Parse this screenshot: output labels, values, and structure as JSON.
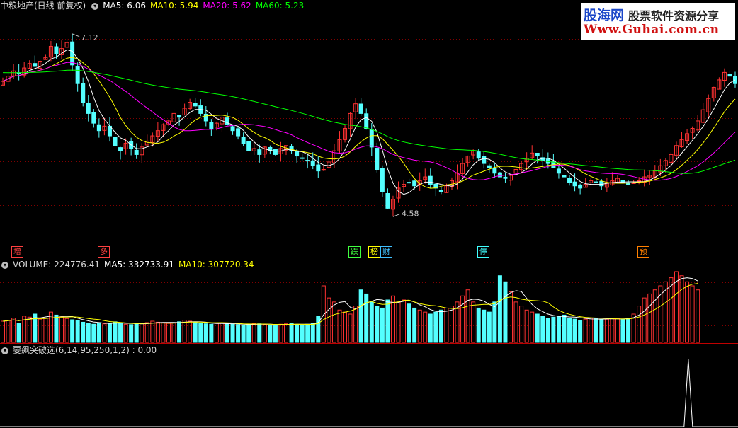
{
  "header": {
    "title": "中粮地产(日线 前复权)",
    "ma5": "MA5: 6.06",
    "ma10": "MA10: 5.94",
    "ma20": "MA20: 5.62",
    "ma60": "MA60: 5.23"
  },
  "volume_header": {
    "title": "VOLUME: 224776.41",
    "ma5": "MA5: 332733.91",
    "ma10": "MA10: 307720.34"
  },
  "indicator_header": {
    "title": "要飙突破选(6,14,95,250,1,2) : 0.00"
  },
  "watermark": {
    "brand": "股海网",
    "slogan": "股票软件资源分享",
    "url": "Www.Guhai.com.cn"
  },
  "colors": {
    "up": "#ff3232",
    "down": "#54ffff",
    "ma5": "#ffffff",
    "ma10": "#ffff00",
    "ma20": "#ff00ff",
    "ma60": "#00ff00",
    "separator": "#c00000"
  },
  "price_markers": {
    "high": "7.12",
    "low": "4.58"
  },
  "event_tags": [
    {
      "text": "增",
      "color": "#ff4040"
    },
    {
      "text": "多",
      "color": "#ff4040"
    },
    {
      "text": "跌",
      "color": "#40ff40"
    },
    {
      "text": "榜",
      "color": "#ffff00"
    },
    {
      "text": "财",
      "color": "#40c0ff"
    },
    {
      "text": "停",
      "color": "#40ffff"
    },
    {
      "text": "预",
      "color": "#ff8000"
    }
  ],
  "chart_data": [
    {
      "type": "candlestick",
      "title": "中粮地产(日线 前复权)",
      "ylim": [
        4.3,
        7.4
      ],
      "series_names": [
        "MA5",
        "MA10",
        "MA20",
        "MA60"
      ],
      "annotations": [
        {
          "label": "7.12",
          "type": "high"
        },
        {
          "label": "4.58",
          "type": "low"
        }
      ],
      "closes": [
        6.48,
        6.55,
        6.62,
        6.58,
        6.66,
        6.72,
        6.68,
        6.75,
        6.8,
        6.95,
        6.85,
        6.92,
        7.0,
        6.7,
        6.45,
        6.2,
        6.05,
        5.92,
        5.82,
        5.88,
        5.75,
        5.62,
        5.55,
        5.65,
        5.58,
        5.5,
        5.6,
        5.68,
        5.75,
        5.82,
        5.9,
        5.95,
        6.05,
        6.0,
        6.12,
        6.2,
        6.15,
        6.05,
        5.95,
        5.85,
        5.92,
        6.0,
        5.9,
        5.82,
        5.75,
        5.65,
        5.55,
        5.58,
        5.5,
        5.6,
        5.55,
        5.5,
        5.58,
        5.62,
        5.55,
        5.48,
        5.45,
        5.42,
        5.35,
        5.28,
        5.3,
        5.4,
        5.55,
        5.7,
        5.85,
        6.05,
        6.18,
        6.05,
        5.85,
        5.6,
        5.3,
        5.0,
        4.78,
        4.9,
        5.05,
        5.1,
        5.12,
        5.08,
        5.15,
        5.2,
        5.1,
        5.05,
        5.0,
        5.08,
        5.15,
        5.25,
        5.38,
        5.48,
        5.55,
        5.45,
        5.38,
        5.32,
        5.25,
        5.2,
        5.18,
        5.22,
        5.3,
        5.38,
        5.45,
        5.52,
        5.48,
        5.42,
        5.38,
        5.32,
        5.25,
        5.2,
        5.12,
        5.08,
        5.05,
        5.1,
        5.15,
        5.12,
        5.08,
        5.12,
        5.15,
        5.18,
        5.12,
        5.1,
        5.12,
        5.15,
        5.2,
        5.22,
        5.28,
        5.35,
        5.42,
        5.5,
        5.62,
        5.7,
        5.78,
        5.85,
        5.95,
        6.1,
        6.25,
        6.4,
        6.5,
        6.6,
        6.55,
        6.45
      ]
    },
    {
      "type": "bar",
      "title": "VOLUME",
      "series_names": [
        "VOLUME",
        "MA5",
        "MA10"
      ],
      "values": [
        105,
        110,
        120,
        95,
        130,
        125,
        140,
        115,
        120,
        150,
        135,
        125,
        118,
        112,
        108,
        100,
        95,
        90,
        98,
        92,
        96,
        102,
        94,
        90,
        88,
        92,
        95,
        98,
        105,
        100,
        96,
        94,
        98,
        102,
        110,
        105,
        98,
        95,
        92,
        90,
        94,
        96,
        92,
        90,
        88,
        85,
        90,
        94,
        92,
        88,
        85,
        86,
        90,
        92,
        94,
        88,
        86,
        90,
        95,
        130,
        280,
        220,
        200,
        160,
        150,
        140,
        180,
        260,
        240,
        200,
        180,
        170,
        210,
        230,
        200,
        210,
        190,
        170,
        160,
        150,
        140,
        150,
        160,
        170,
        180,
        200,
        230,
        260,
        200,
        170,
        160,
        150,
        200,
        330,
        300,
        250,
        200,
        180,
        160,
        150,
        140,
        130,
        120,
        125,
        130,
        135,
        120,
        115,
        110,
        115,
        120,
        118,
        112,
        115,
        120,
        118,
        115,
        120,
        140,
        180,
        220,
        240,
        260,
        280,
        300,
        320,
        350,
        330,
        300,
        280,
        260
      ]
    },
    {
      "type": "line",
      "title": "要飙突破选(6,14,95,250,1,2)",
      "series_names": [
        "要飙突破选"
      ],
      "current_value": 0.0,
      "spike_fraction": 0.936,
      "spike_value": 1
    }
  ]
}
